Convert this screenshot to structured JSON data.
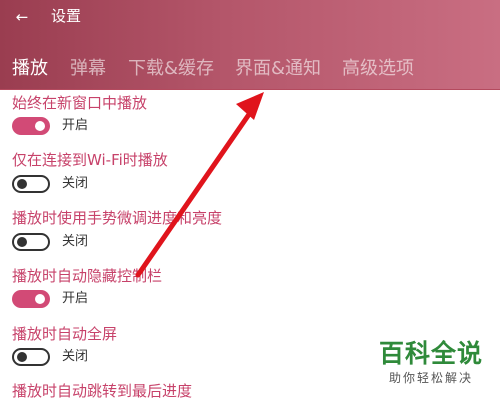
{
  "header": {
    "back_icon": "back-arrow-icon",
    "back_glyph": "←",
    "title": "设置",
    "gradient_colors": [
      "#9a3d50",
      "#c96e82"
    ]
  },
  "tabs": [
    {
      "label": "播放",
      "active": true
    },
    {
      "label": "弹幕",
      "active": false
    },
    {
      "label": "下载&缓存",
      "active": false
    },
    {
      "label": "界面&通知",
      "active": false
    },
    {
      "label": "高级选项",
      "active": false
    }
  ],
  "settings": [
    {
      "label": "始终在新窗口中播放",
      "state": "on",
      "state_text": "开启"
    },
    {
      "label": "仅在连接到Wi-Fi时播放",
      "state": "off",
      "state_text": "关闭"
    },
    {
      "label": "播放时使用手势微调进度和亮度",
      "state": "off",
      "state_text": "关闭"
    },
    {
      "label": "播放时自动隐藏控制栏",
      "state": "on",
      "state_text": "开启"
    },
    {
      "label": "播放时自动全屏",
      "state": "off",
      "state_text": "关闭"
    },
    {
      "label": "播放时自动跳转到最后进度"
    }
  ],
  "annotation": {
    "color": "#e0141c",
    "icon": "red-arrow-annotation"
  },
  "watermark": {
    "title": "百科全说",
    "subtitle": "助你轻松解决"
  },
  "colors": {
    "accent": "#d24a76",
    "label": "#c7426a"
  }
}
